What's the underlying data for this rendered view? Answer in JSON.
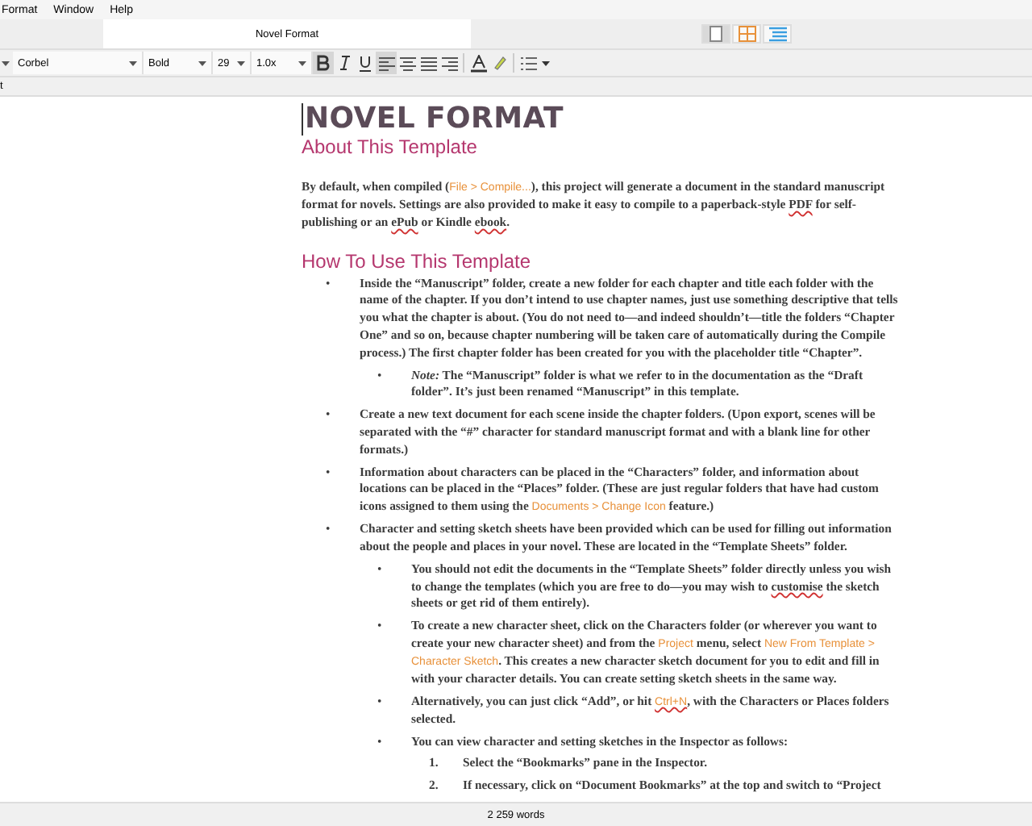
{
  "menu_bar": {
    "items": [
      "Format",
      "Window",
      "Help"
    ]
  },
  "tab_bar": {
    "title": "Novel Format",
    "view_modes": [
      {
        "kind": "document",
        "selected": true
      },
      {
        "kind": "corkboard",
        "selected": false
      },
      {
        "kind": "outline",
        "selected": false
      }
    ]
  },
  "format_bar": {
    "font": "Corbel",
    "weight": "Bold",
    "size": "29",
    "line_spacing": "1.0x",
    "bold": true,
    "italic": false,
    "underline": false,
    "align_buttons": [
      {
        "kind": "left",
        "selected": true
      },
      {
        "kind": "center",
        "selected": false
      },
      {
        "kind": "justify",
        "selected": false
      },
      {
        "kind": "right",
        "selected": false
      }
    ]
  },
  "header_fragment": "t",
  "document": {
    "title": "NOVEL FORMAT",
    "blocks": [
      {
        "kind": "subheading",
        "text": "About This Template"
      },
      {
        "kind": "paragraph",
        "segments": [
          {
            "kind": "plain",
            "text": "By default, when compiled ("
          },
          {
            "kind": "menu",
            "text": "File > Compile..."
          },
          {
            "kind": "plain",
            "text": "), this project will generate a document in the standard manuscript format for novels. Settings are also provided to make it easy to compile to a paperback-style "
          },
          {
            "kind": "misspelled",
            "text": "PDF"
          },
          {
            "kind": "plain",
            "text": " for self-publishing or an "
          },
          {
            "kind": "misspelled",
            "text": "ePub"
          },
          {
            "kind": "plain",
            "text": " or Kindle "
          },
          {
            "kind": "misspelled",
            "text": "ebook"
          },
          {
            "kind": "plain",
            "text": "."
          }
        ]
      },
      {
        "kind": "heading",
        "text": "How To Use This Template"
      },
      {
        "kind": "list",
        "items": [
          {
            "marker": "•",
            "segments": [
              {
                "kind": "plain",
                "text": "Inside the “Manuscript” folder, create a new folder for each chapter and title each folder with the name of the chapter. If you don’t intend to use chapter names, just use something descriptive that tells you what the chapter is about. (You do not need to—and indeed shouldn’t—title the folders “Chapter One” and so on, because chapter numbering will be taken care of automatically during the Compile process.) The first chapter folder has been created for you with the placeholder title “Chapter”."
              }
            ],
            "children": [
              {
                "marker": "•",
                "segments": [
                  {
                    "kind": "plain",
                    "text": "*Note:* The “Manuscript” folder is what we refer to in the documentation as the “Draft folder”. It’s just been renamed “Manuscript” in this template."
                  }
                ]
              }
            ]
          },
          {
            "marker": "•",
            "segments": [
              {
                "kind": "plain",
                "text": "Create a new text document for each scene inside the chapter folders. (Upon export, scenes will be separated with the “#” character for standard manuscript format and with a blank line for other formats.)"
              }
            ]
          },
          {
            "marker": "•",
            "segments": [
              {
                "kind": "plain",
                "text": "Information about characters can be placed in the “Characters” folder, and information about locations can be placed in the “Places” folder. (These are just regular folders that have had custom icons assigned to them using the "
              },
              {
                "kind": "menu",
                "text": "Documents > Change Icon"
              },
              {
                "kind": "plain",
                "text": " feature.)"
              }
            ]
          },
          {
            "marker": "•",
            "segments": [
              {
                "kind": "plain",
                "text": "Character and setting sketch sheets have been provided which can be used for filling out information about the people and places in your novel. These are located in the “Template Sheets” folder."
              }
            ],
            "children": [
              {
                "marker": "•",
                "segments": [
                  {
                    "kind": "plain",
                    "text": "You should not edit the documents in the “Template Sheets” folder directly unless you wish to change the templates (which you are free to do—you may wish to "
                  },
                  {
                    "kind": "misspelled",
                    "text": "customise"
                  },
                  {
                    "kind": "plain",
                    "text": " the sketch sheets or get rid of them entirely)."
                  }
                ]
              },
              {
                "marker": "•",
                "segments": [
                  {
                    "kind": "plain",
                    "text": "To create a new character sheet, click on the Characters folder (or wherever you want to create your new character sheet) and from the "
                  },
                  {
                    "kind": "menu",
                    "text": "Project"
                  },
                  {
                    "kind": "plain",
                    "text": " menu, select "
                  },
                  {
                    "kind": "menu",
                    "text": "New From Template > Character Sketch"
                  },
                  {
                    "kind": "plain",
                    "text": ". This creates a new character sketch document for you to edit and fill in with your character details. You can create setting sketch sheets in the same way."
                  }
                ]
              },
              {
                "marker": "•",
                "segments": [
                  {
                    "kind": "plain",
                    "text": "Alternatively, you can just click “Add”, or hit "
                  },
                  {
                    "kind": "misspelled-menu",
                    "text": "Ctrl+N"
                  },
                  {
                    "kind": "plain",
                    "text": ", with the Characters or Places folders selected."
                  }
                ]
              },
              {
                "marker": "•",
                "segments": [
                  {
                    "kind": "plain",
                    "text": "You can view character and setting sketches in the Inspector as follows:"
                  }
                ],
                "children": [
                  {
                    "marker": "1.",
                    "segments": [
                      {
                        "kind": "plain",
                        "text": "Select the “Bookmarks” pane in the Inspector."
                      }
                    ]
                  },
                  {
                    "marker": "2.",
                    "segments": [
                      {
                        "kind": "plain",
                        "text": "If necessary, click on “Document Bookmarks” at the top and switch to “Project"
                      }
                    ]
                  }
                ]
              }
            ]
          }
        ]
      }
    ]
  },
  "status_bar": {
    "word_count": "2 259 words"
  }
}
